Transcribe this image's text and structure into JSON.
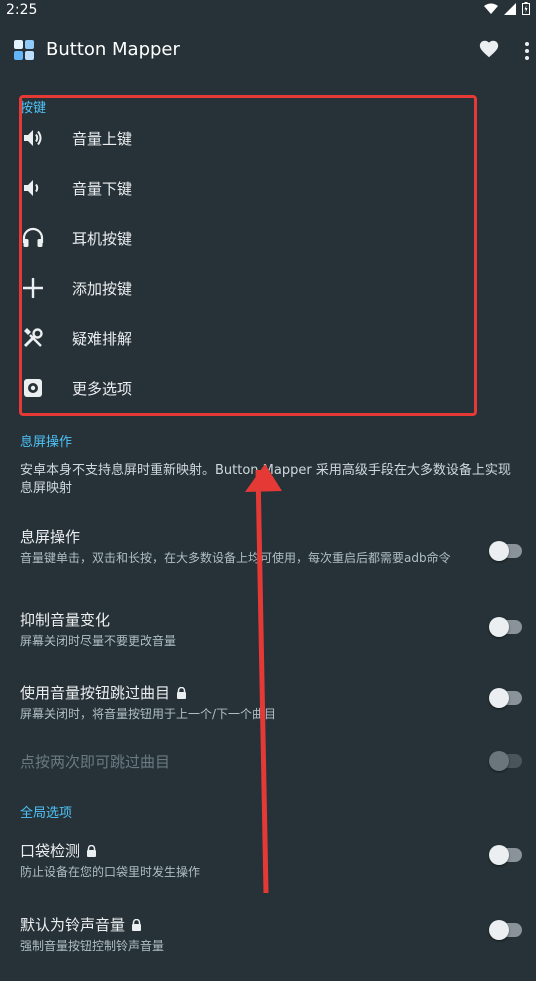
{
  "status_bar": {
    "time": "2:25"
  },
  "app": {
    "title": "Button Mapper"
  },
  "colors": {
    "background": "#263238",
    "accent": "#4fc3f7",
    "highlight": "#e53935",
    "toggle_off": "#8a9399"
  },
  "sections": {
    "buttons_header": "按键",
    "screen_off_header": "息屏操作",
    "global_header": "全局选项"
  },
  "menu": [
    {
      "icon": "volume-up-icon",
      "label": "音量上键"
    },
    {
      "icon": "volume-down-icon",
      "label": "音量下键"
    },
    {
      "icon": "headset-icon",
      "label": "耳机按键"
    },
    {
      "icon": "add-icon",
      "label": "添加按键"
    },
    {
      "icon": "tools-icon",
      "label": "疑难排解"
    },
    {
      "icon": "settings-icon",
      "label": "更多选项"
    }
  ],
  "screen_off_description": "安卓本身不支持息屏时重新映射。Button Mapper 采用高级手段在大多数设备上实现息屏映射",
  "settings": [
    {
      "title": "息屏操作",
      "subtitle": "音量键单击，双击和长按，在大多数设备上均可使用，每次重启后都需要adb命令",
      "locked": false,
      "enabled": true,
      "on": false
    },
    {
      "title": "抑制音量变化",
      "subtitle": "屏幕关闭时尽量不要更改音量",
      "locked": false,
      "enabled": true,
      "on": false
    },
    {
      "title": "使用音量按钮跳过曲目",
      "subtitle": "屏幕关闭时，将音量按钮用于上一个/下一个曲目",
      "locked": true,
      "enabled": true,
      "on": false
    },
    {
      "title": "点按两次即可跳过曲目",
      "subtitle": "",
      "locked": false,
      "enabled": false,
      "on": false
    },
    {
      "title": "口袋检测",
      "subtitle": "防止设备在您的口袋里时发生操作",
      "locked": true,
      "enabled": true,
      "on": false
    },
    {
      "title": "默认为铃声音量",
      "subtitle": "强制音量按钮控制铃声音量",
      "locked": true,
      "enabled": true,
      "on": false
    }
  ]
}
